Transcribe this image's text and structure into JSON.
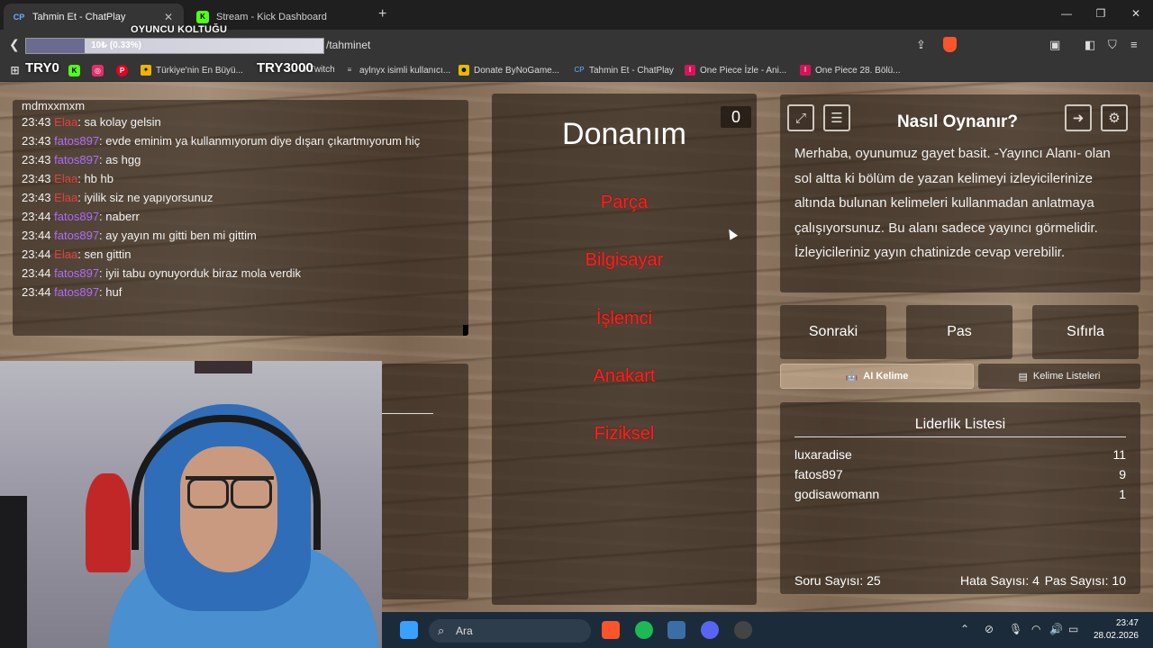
{
  "browser": {
    "tabs": [
      {
        "title": "Tahmin Et - ChatPlay",
        "favicon": "chatplay-icon",
        "active": true
      },
      {
        "title": "Stream - Kick Dashboard",
        "favicon": "kick-icon",
        "active": false
      }
    ],
    "url_visible": "/tahminet",
    "bookmarks": [
      "Türkiye'nin En Büyü...",
      "/ Twitch",
      "aylnyx isimli kullanıcı...",
      "Donate ByNoGame...",
      "Tahmin Et - ChatPlay",
      "One Piece İzle - Ani...",
      "One Piece 28. Bölü..."
    ]
  },
  "overlay": {
    "seat_title": "OYUNCU KOLTUĞU",
    "seat_bar_label": "10₺ (0.33%)",
    "seat_progress_fraction": 0.0033,
    "left_tag": "TRY0",
    "right_tag": "TRY3000"
  },
  "chat": {
    "partial_top": "mdmxxmxm",
    "messages": [
      {
        "time": "23:43",
        "user": "Elaa",
        "user_color": "red",
        "text": "sa kolay gelsin"
      },
      {
        "time": "23:43",
        "user": "fatos897",
        "user_color": "purple",
        "text": "evde eminim ya kullanmıyorum diye dışarı çıkartmıyorum hiç"
      },
      {
        "time": "23:43",
        "user": "fatos897",
        "user_color": "purple",
        "text": "as hgg"
      },
      {
        "time": "23:43",
        "user": "Elaa",
        "user_color": "red",
        "text": "hb hb"
      },
      {
        "time": "23:43",
        "user": "Elaa",
        "user_color": "red",
        "text": "iyilik siz ne yapıyorsunuz"
      },
      {
        "time": "23:44",
        "user": "fatos897",
        "user_color": "purple",
        "text": "naberr"
      },
      {
        "time": "23:44",
        "user": "fatos897",
        "user_color": "purple",
        "text": "ay yayın mı gitti ben mi gittim"
      },
      {
        "time": "23:44",
        "user": "Elaa",
        "user_color": "red",
        "text": "sen gittin"
      },
      {
        "time": "23:44",
        "user": "fatos897",
        "user_color": "purple",
        "text": "iyii tabu oynuyorduk biraz mola verdik"
      },
      {
        "time": "23:44",
        "user": "fatos897",
        "user_color": "purple",
        "text": "huf"
      }
    ]
  },
  "game": {
    "counter": "0",
    "main_word": "Donanım",
    "forbidden_words": [
      "Parça",
      "Bilgisayar",
      "İşlemci",
      "Anakart",
      "Fiziksel"
    ],
    "howto_title": "Nasıl Oynanır?",
    "howto_text": "Merhaba, oyunumuz gayet basit. -Yayıncı Alanı- olan sol altta ki bölüm de yazan kelimeyi izleyicilerinize altında bulunan kelimeleri kullanmadan anlatmaya çalışıyorsunuz. Bu alanı sadece yayıncı görmelidir. İzleyicileriniz yayın chatinizde cevap verebilir.",
    "buttons": {
      "next": "Sonraki",
      "pass": "Pas",
      "reset": "Sıfırla"
    },
    "tabs": {
      "ai": "AI Kelime",
      "lists": "Kelime Listeleri"
    },
    "leaderboard_title": "Liderlik Listesi",
    "leaderboard": [
      {
        "name": "luxaradise",
        "score": "11"
      },
      {
        "name": "fatos897",
        "score": "9"
      },
      {
        "name": "godisawomann",
        "score": "1"
      }
    ],
    "stats": {
      "questions": "Soru Sayısı: 25",
      "errors": "Hata Sayısı: 4",
      "passes": "Pas Sayısı: 10"
    }
  },
  "taskbar": {
    "search_label": "Ara",
    "time": "23:47",
    "date": "28.02.2026"
  },
  "colors": {
    "forbidden": "#ff1f1f",
    "user_purple": "#b06bff",
    "user_red": "#e04040",
    "accent_ai": "#d7bea0"
  }
}
